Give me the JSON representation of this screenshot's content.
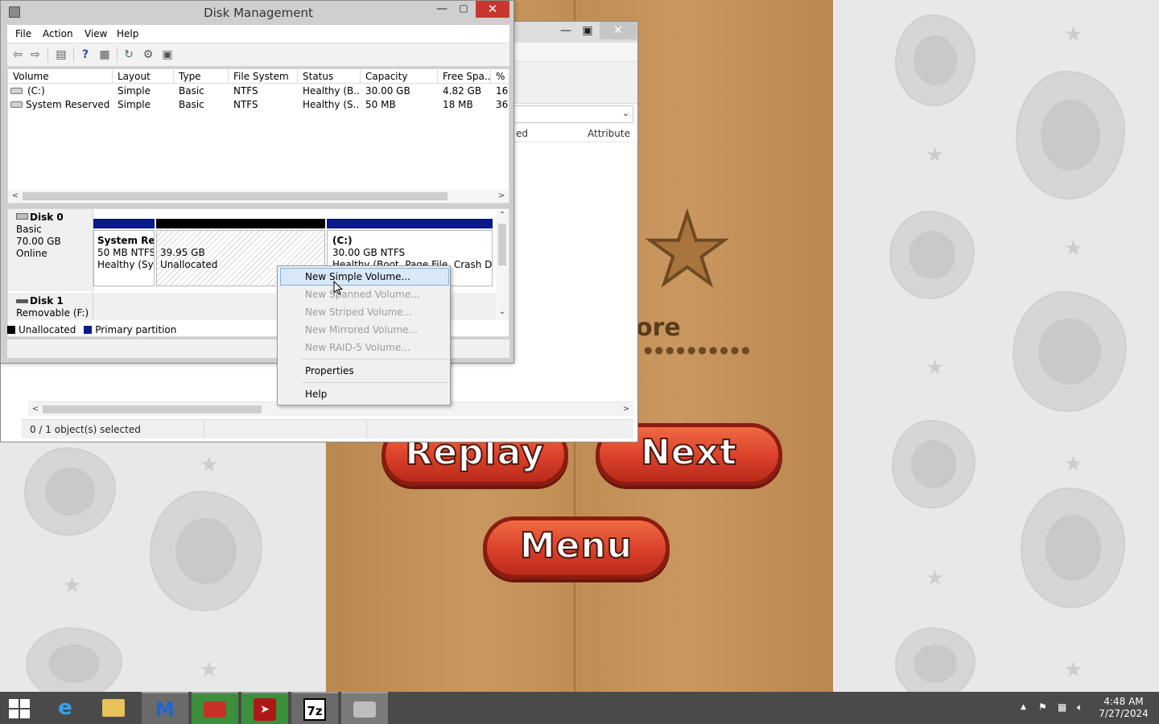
{
  "disk_management": {
    "title": "Disk Management",
    "menu": [
      "File",
      "Action",
      "View",
      "Help"
    ],
    "columns": [
      "Volume",
      "Layout",
      "Type",
      "File System",
      "Status",
      "Capacity",
      "Free Spa...",
      "% F"
    ],
    "volumes": [
      {
        "volume": "(C:)",
        "layout": "Simple",
        "type": "Basic",
        "fs": "NTFS",
        "status": "Healthy (B...",
        "capacity": "30.00 GB",
        "free": "4.82 GB",
        "pct": "16"
      },
      {
        "volume": "System Reserved",
        "layout": "Simple",
        "type": "Basic",
        "fs": "NTFS",
        "status": "Healthy (S...",
        "capacity": "50 MB",
        "free": "18 MB",
        "pct": "36"
      }
    ],
    "disk0": {
      "name": "Disk 0",
      "type": "Basic",
      "size": "70.00 GB",
      "state": "Online",
      "partitions": [
        {
          "name": "System Res",
          "size": "50 MB NTFS",
          "status": "Healthy (Sys"
        },
        {
          "name": "",
          "size": "39.95 GB",
          "status": "Unallocated"
        },
        {
          "name": "(C:)",
          "size": "30.00 GB NTFS",
          "status": "Healthy (Boot, Page File, Crash Dum"
        }
      ]
    },
    "disk1": {
      "name": "Disk 1",
      "type": "Removable (F:)"
    },
    "legend": [
      {
        "label": "Unallocated",
        "color": "#000000"
      },
      {
        "label": "Primary partition",
        "color": "#0a1a8c"
      }
    ]
  },
  "context_menu": {
    "items": [
      {
        "label": "New Simple Volume...",
        "enabled": true,
        "highlighted": true
      },
      {
        "label": "New Spanned Volume...",
        "enabled": false
      },
      {
        "label": "New Striped Volume...",
        "enabled": false
      },
      {
        "label": "New Mirrored Volume...",
        "enabled": false
      },
      {
        "label": "New RAID-5 Volume...",
        "enabled": false
      },
      {
        "label": "Properties",
        "enabled": true
      },
      {
        "label": "Help",
        "enabled": true
      }
    ]
  },
  "background_window": {
    "column_partial": "ed",
    "column_attributes": "Attribute",
    "status": "0 / 1 object(s) selected"
  },
  "game": {
    "partial_text": "ore",
    "buttons": {
      "replay": "Replay",
      "next": "Next",
      "menu": "Menu"
    }
  },
  "taskbar": {
    "apps": [
      "internet-explorer",
      "file-explorer",
      "malwarebytes",
      "winrar-like",
      "pdf-reader",
      "7zip",
      "disk-management"
    ],
    "seven_zip_label": "7z",
    "clock": {
      "time": "4:48 AM",
      "date": "7/27/2024"
    }
  },
  "colors": {
    "primary_partition": "#0a1a8c",
    "unallocated": "#000000",
    "accent_close": "#c7372f",
    "menu_highlight": "#d9e8f7"
  }
}
